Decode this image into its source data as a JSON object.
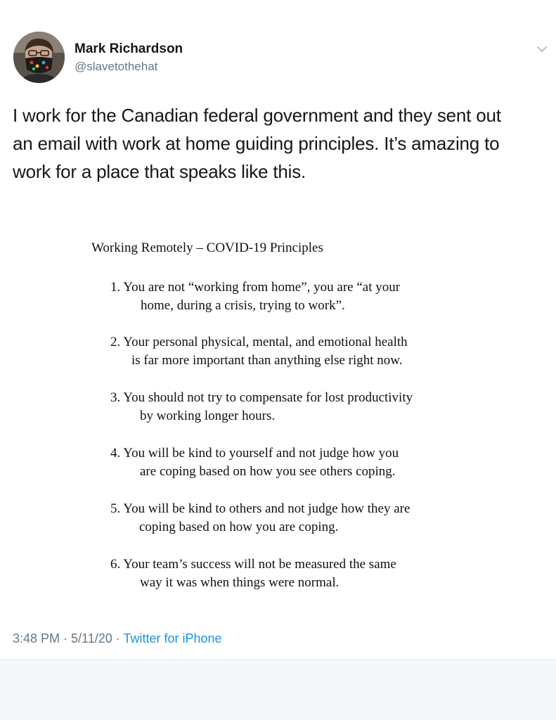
{
  "tweet": {
    "author": {
      "display_name": "Mark Richardson",
      "handle": "@slavetothehat"
    },
    "text": "I work for the Canadian federal government and they sent out an email with work at home guiding principles. It’s amazing to work for a place that speaks like this.",
    "text_lines": [
      "I work for the Canadian federal government and they sent out",
      "an email with work at home guiding principles. It’s amazing to",
      "work for a place that speaks like this."
    ],
    "menu_icon": "chevron-down-icon",
    "image": {
      "title": "Working Remotely – COVID-19 Principles",
      "principles": [
        {
          "line1": "1. You are not “working from home”, you are “at your",
          "line2": "home, during a crisis, trying to work”."
        },
        {
          "line1": "2. Your personal physical, mental, and emotional health",
          "line2": "is far more important than anything else right now."
        },
        {
          "line1": "3. You should not try to compensate for lost productivity",
          "line2": "by working longer hours."
        },
        {
          "line1": "4. You will be kind to yourself and not judge how you",
          "line2": "are coping based on how you see others coping."
        },
        {
          "line1": "5. You will be kind to others and not judge how they are",
          "line2": "coping based on how you are coping."
        },
        {
          "line1": "6. Your team’s success will not be measured the same",
          "line2": "way it was when things were normal."
        }
      ]
    },
    "meta": {
      "time": "3:48 PM",
      "separator1": " · ",
      "date": "5/11/20",
      "separator2": " · ",
      "source": "Twitter for iPhone"
    }
  },
  "colors": {
    "text_primary": "#14171a",
    "text_secondary": "#657786",
    "link": "#1b95e0",
    "divider": "#e1e8ed",
    "background_below": "#f5f8fa"
  }
}
